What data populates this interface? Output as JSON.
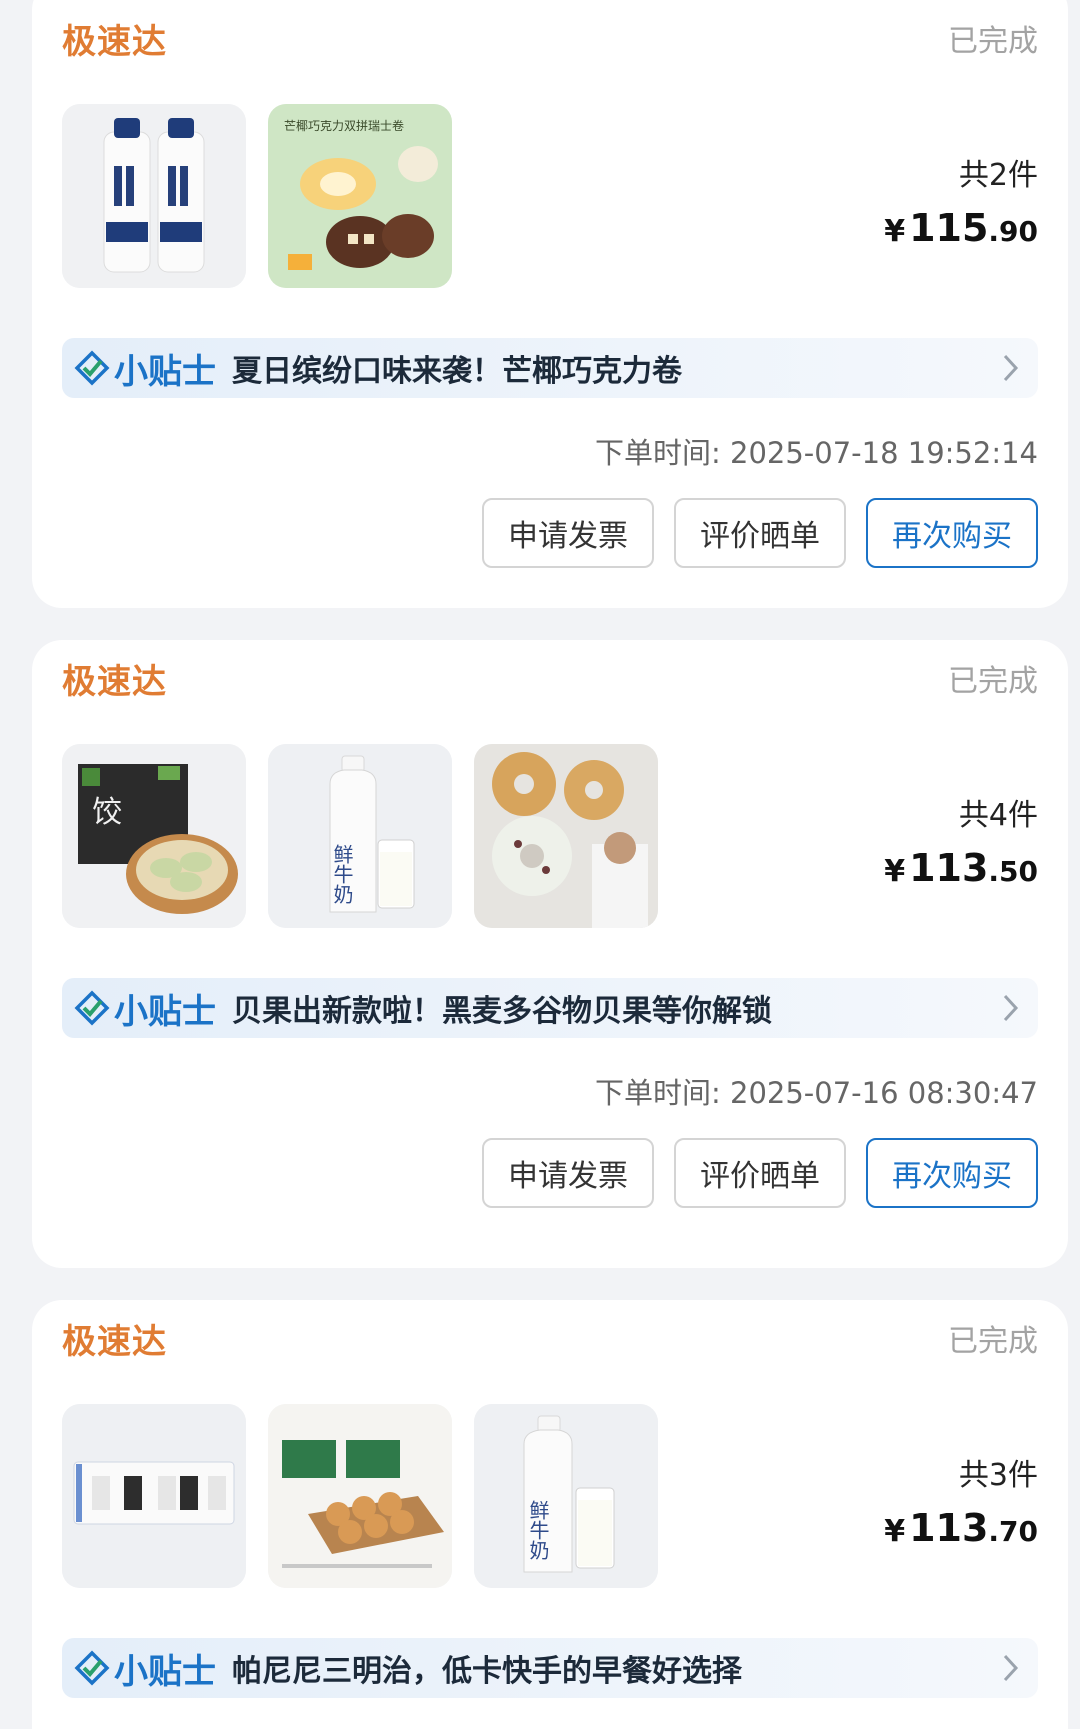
{
  "orders": [
    {
      "brand": "极速达",
      "status": "已完成",
      "product_images": [
        "milk-twin-bottles",
        "mango-coconut-chocolate-roll"
      ],
      "image_text": {
        "roll_title": "芒椰巧克力双拼瑞士卷"
      },
      "quantity": "共2件",
      "price_symbol": "¥",
      "price_int": "115",
      "price_dec": ".90",
      "tip_title": "小贴士",
      "tip_text": "夏日缤纷口味来袭！芒椰巧克力卷",
      "order_time": "下单时间: 2025-07-18 19:52:14",
      "buttons": {
        "invoice": "申请发票",
        "review": "评价晒单",
        "rebuy": "再次购买"
      }
    },
    {
      "brand": "极速达",
      "status": "已完成",
      "product_images": [
        "dumplings-box",
        "fresh-milk-bottle",
        "bagels"
      ],
      "image_text": {
        "milk_label": "鲜牛奶"
      },
      "quantity": "共4件",
      "price_symbol": "¥",
      "price_int": "113",
      "price_dec": ".50",
      "tip_title": "小贴士",
      "tip_text": "贝果出新款啦！黑麦多谷物贝果等你解锁",
      "order_time": "下单时间: 2025-07-16 08:30:47",
      "buttons": {
        "invoice": "申请发票",
        "review": "评价晒单",
        "rebuy": "再次购买"
      }
    },
    {
      "brand": "极速达",
      "status": "已完成",
      "product_images": [
        "sandwich-pack",
        "bread-rolls-tray",
        "fresh-milk-bottle"
      ],
      "image_text": {
        "milk_label": "鲜牛奶"
      },
      "quantity": "共3件",
      "price_symbol": "¥",
      "price_int": "113",
      "price_dec": ".70",
      "tip_title": "小贴士",
      "tip_text": "帕尼尼三明治，低卡快手的早餐好选择"
    }
  ],
  "colors": {
    "brand_orange": "#e07c33",
    "accent_blue": "#1b73c7",
    "page_bg": "#f2f3f6"
  },
  "icons": {
    "tip": "check-diamond-icon",
    "arrow": "chevron-right-icon"
  }
}
